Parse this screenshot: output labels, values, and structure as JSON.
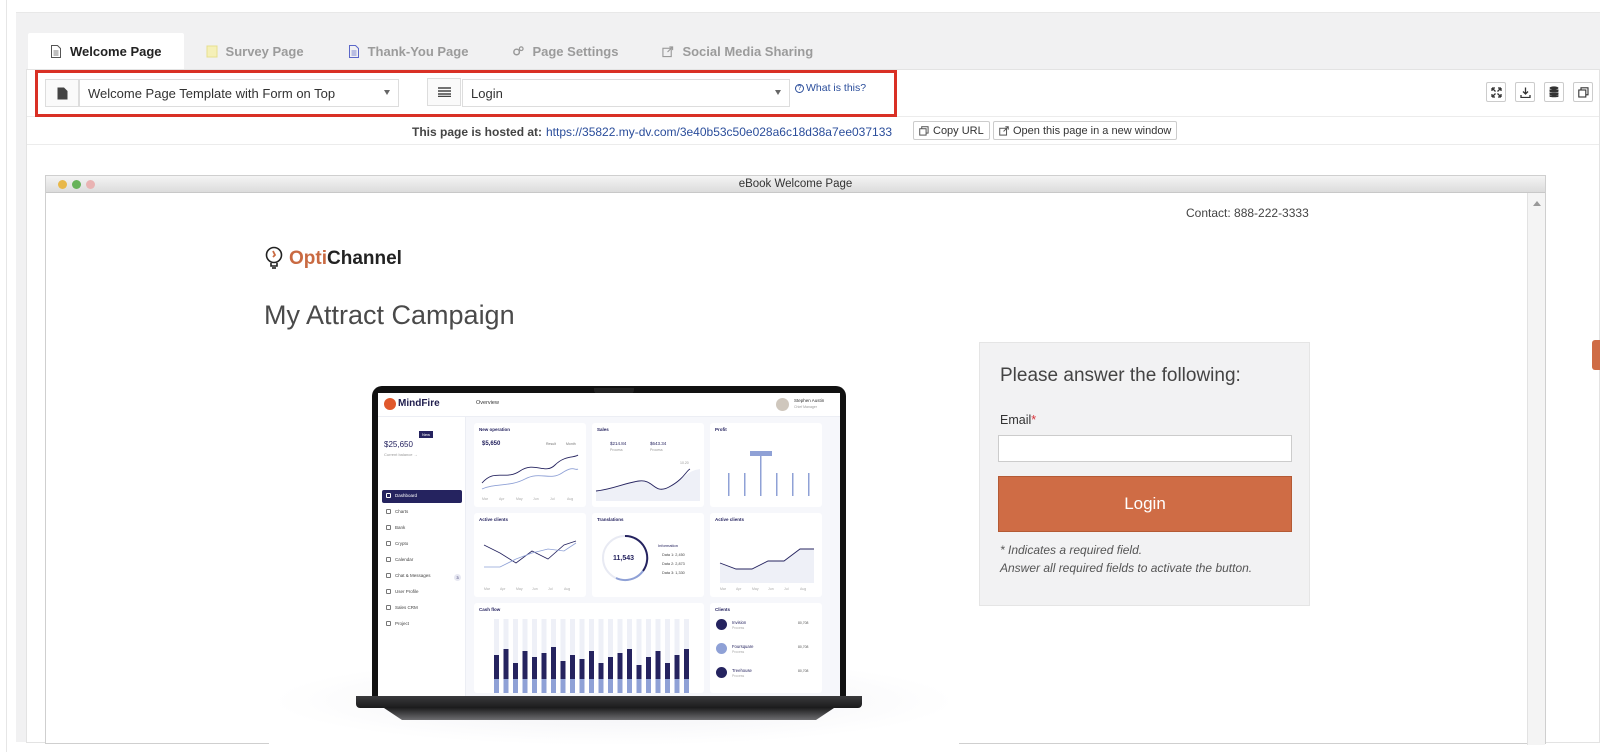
{
  "tabs": [
    {
      "label": "Welcome Page",
      "icon": "document-icon",
      "active": true
    },
    {
      "label": "Survey Page",
      "icon": "survey-icon",
      "active": false
    },
    {
      "label": "Thank-You Page",
      "icon": "document-icon",
      "active": false
    },
    {
      "label": "Page Settings",
      "icon": "gears-icon",
      "active": false
    },
    {
      "label": "Social Media Sharing",
      "icon": "share-icon",
      "active": false
    }
  ],
  "toolbar": {
    "template_select": "Welcome Page Template with Form on Top",
    "form_select": "Login",
    "help_link": "What is this?"
  },
  "hosting": {
    "label": "This page is hosted at:",
    "url": "https://35822.my-dv.com/3e40b53c50e028a6c18d38a7ee037133",
    "copy_button": "Copy URL",
    "open_button": "Open this page in a new window"
  },
  "preview": {
    "window_title": "eBook Welcome Page",
    "contact": "Contact: 888-222-3333",
    "logo_part1": "Opti",
    "logo_part2": "Channel",
    "campaign_title": "My Attract Campaign",
    "form": {
      "title": "Please answer the following:",
      "email_label": "Email",
      "required_mark": "*",
      "button": "Login",
      "note1": "* Indicates a required field.",
      "note2": "Answer all required fields to activate the button."
    }
  },
  "dashboard": {
    "brand": "MindFire",
    "header": "Overview",
    "user_name": "Stephen Austin",
    "user_role": "Chief Manager",
    "balance": "$25,650",
    "balance_label": "Current balance →",
    "new_badge": "New",
    "nav": [
      "Dashboard",
      "Charts",
      "Bank",
      "Crypto",
      "Calendar",
      "Chat & Messages",
      "User Profile",
      "Sales CRM",
      "Project"
    ],
    "nav_badge": "3",
    "cards": {
      "new_operation": "New operation",
      "new_operation_value": "$5,650",
      "new_operation_legend": [
        "Result",
        "Month"
      ],
      "sales": "Sales",
      "sales_value1": "$214.84",
      "sales_value2": "$643.34",
      "sales_sub1": "Process",
      "sales_sub2": "Process",
      "sales_point": "10.20",
      "profit": "Profit",
      "profit_tag": "4.800",
      "active_clients": "Active clients",
      "translations": "Translations",
      "translations_value": "11,543",
      "info_title": "Information",
      "info_items": [
        "Data 1: 2,450",
        "Data 2: 2,873",
        "Data 3: 1,330"
      ],
      "active_clients2": "Active clients",
      "cash_flow": "Cash flow",
      "clients": "Clients",
      "client_names": [
        "Invision",
        "Foursquare",
        "Treehouse"
      ],
      "client_sub": "Process",
      "client_value": "80,708"
    },
    "months": [
      "Mar",
      "Apr",
      "May",
      "Jun",
      "Jul",
      "Aug"
    ]
  },
  "colors": {
    "accent": "#cf6c45",
    "link": "#2a4d9b",
    "highlight_border": "#d93025",
    "dashboard_navy": "#25235f"
  }
}
